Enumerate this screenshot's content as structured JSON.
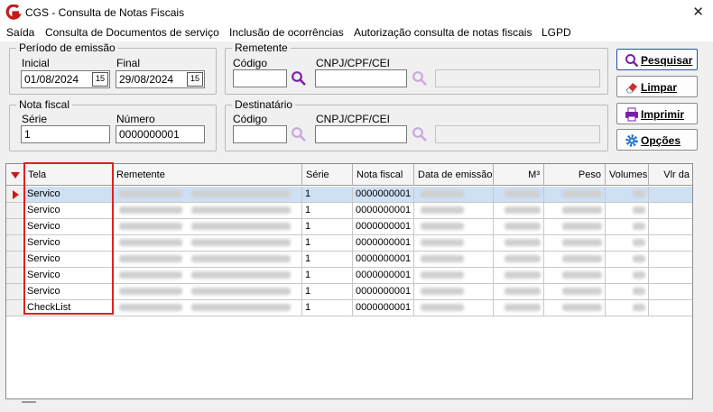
{
  "window": {
    "title": "CGS - Consulta de Notas Fiscais",
    "close": "✕"
  },
  "menu": [
    "Saída",
    "Consulta de Documentos de serviço",
    "Inclusão de ocorrências",
    "Autorização consulta de notas fiscais",
    "LGPD"
  ],
  "periodo": {
    "legend": "Período de emissão",
    "inicial_label": "Inicial",
    "inicial_value": "01/08/2024",
    "final_label": "Final",
    "final_value": "29/08/2024",
    "cal_icon": "15"
  },
  "remetente": {
    "legend": "Remetente",
    "codigo_label": "Código",
    "codigo_value": "",
    "cnpj_label": "CNPJ/CPF/CEI",
    "cnpj_value": "",
    "nome_value": ""
  },
  "nota": {
    "legend": "Nota fiscal",
    "serie_label": "Série",
    "serie_value": "1",
    "numero_label": "Número",
    "numero_value": "0000000001"
  },
  "destinatario": {
    "legend": "Destinatário",
    "codigo_label": "Código",
    "codigo_value": "",
    "cnpj_label": "CNPJ/CPF/CEI",
    "cnpj_value": "",
    "nome_value": ""
  },
  "buttons": {
    "pesquisar": "Pesquisar",
    "limpar": "Limpar",
    "imprimir": "Imprimir",
    "opcoes": "Opções"
  },
  "grid": {
    "columns": [
      "Tela",
      "Remetente",
      "Série",
      "Nota fiscal",
      "Data de emissão",
      "M³",
      "Peso",
      "Volumes",
      "Vlr da"
    ],
    "rows": [
      {
        "tela": "Servico",
        "serie": "1",
        "nota": "0000000001"
      },
      {
        "tela": "Servico",
        "serie": "1",
        "nota": "0000000001"
      },
      {
        "tela": "Servico",
        "serie": "1",
        "nota": "0000000001"
      },
      {
        "tela": "Servico",
        "serie": "1",
        "nota": "0000000001"
      },
      {
        "tela": "Servico",
        "serie": "1",
        "nota": "0000000001"
      },
      {
        "tela": "Servico",
        "serie": "1",
        "nota": "0000000001"
      },
      {
        "tela": "Servico",
        "serie": "1",
        "nota": "0000000001"
      },
      {
        "tela": "CheckList",
        "serie": "1",
        "nota": "0000000001"
      }
    ]
  },
  "colors": {
    "accent": "#1f4fa6",
    "highlight": "#e02020",
    "icon_red": "#c41c1c",
    "lupa": "#7a1fa8"
  }
}
